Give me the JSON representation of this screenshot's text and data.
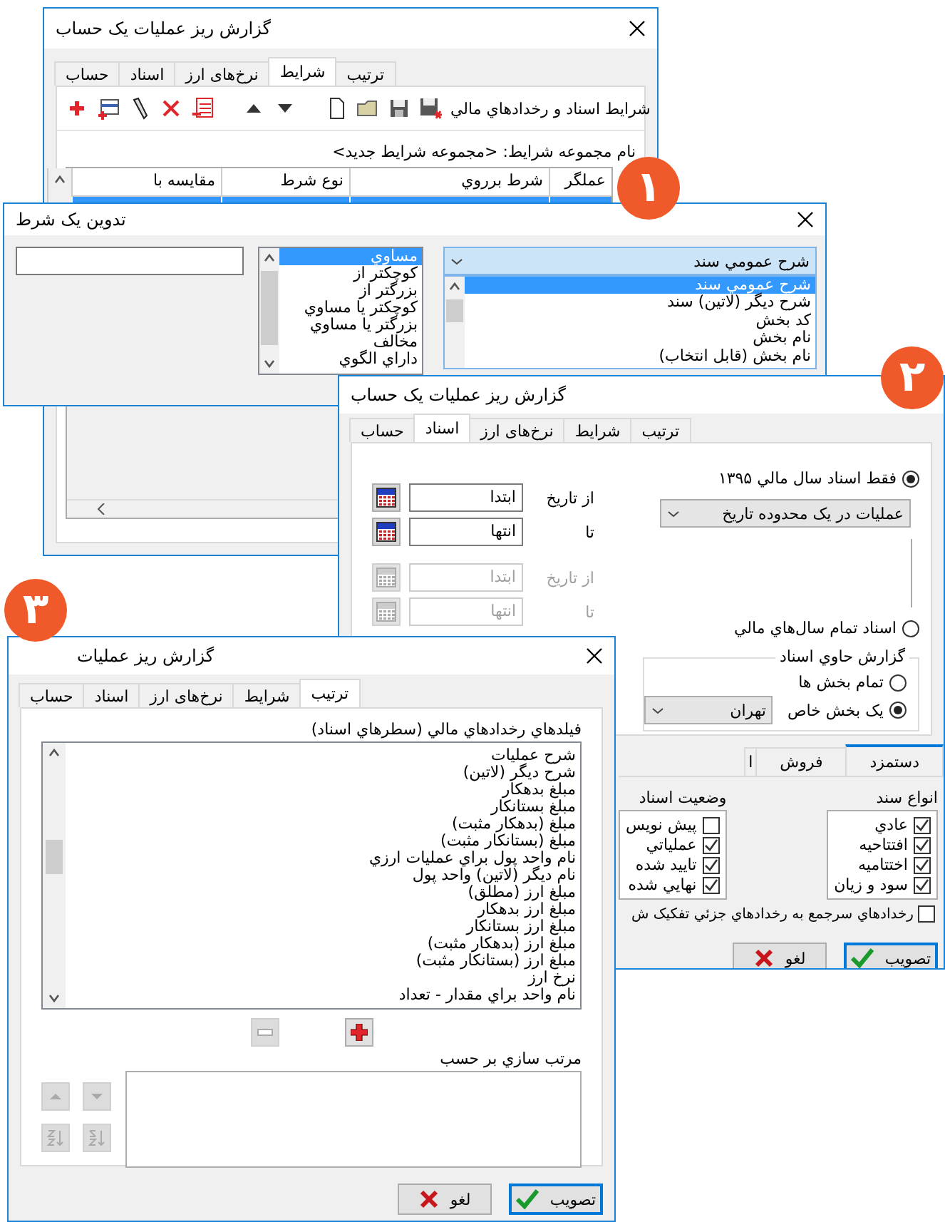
{
  "conditions_window": {
    "title": "گزارش ریز عملیات یک حساب",
    "tabs": [
      {
        "label": "ترتیب",
        "selected": false
      },
      {
        "label": "شرایط",
        "selected": true
      },
      {
        "label": "نرخ‌های ارز",
        "selected": false
      },
      {
        "label": "اسناد",
        "selected": false
      },
      {
        "label": "حساب",
        "selected": false
      }
    ],
    "toolbar_label": "شرایط اسناد و رخدادهاي مالي",
    "set_name": "نام مجموعه شرایط: <مجموعه شرایط جدید>",
    "table": {
      "columns": [
        "عملگر",
        "شرط برروي",
        "نوع شرط",
        "مقایسه با"
      ],
      "rows": [
        {
          "selected": true
        }
      ]
    }
  },
  "edit_condition_dialog": {
    "title": "تدوین یک شرط",
    "field_combo": {
      "value": "شرح عمومي سند",
      "options": [
        {
          "label": "شرح عمومي سند",
          "selected": true
        },
        {
          "label": "شرح دیگر (لاتین) سند",
          "selected": false
        },
        {
          "label": "کد بخش",
          "selected": false
        },
        {
          "label": "نام بخش",
          "selected": false
        },
        {
          "label": "نام بخش (قابل انتخاب)",
          "selected": false
        }
      ]
    },
    "operators": [
      {
        "label": "مساوي",
        "selected": true
      },
      {
        "label": "کوچکتر از",
        "selected": false
      },
      {
        "label": "بزرگتر از",
        "selected": false
      },
      {
        "label": "کوچکتر یا مساوي",
        "selected": false
      },
      {
        "label": "بزرگتر یا مساوي",
        "selected": false
      },
      {
        "label": "مخالف",
        "selected": false
      },
      {
        "label": "داراي الگوي",
        "selected": false
      }
    ]
  },
  "documents_window": {
    "title": "گزارش ریز عملیات یک حساب",
    "tabs": [
      {
        "label": "ترتیب",
        "selected": false
      },
      {
        "label": "شرایط",
        "selected": false
      },
      {
        "label": "نرخ‌های ارز",
        "selected": false
      },
      {
        "label": "اسناد",
        "selected": true
      },
      {
        "label": "حساب",
        "selected": false
      }
    ],
    "scope_options": [
      {
        "label": "فقط اسناد سال مالي ۱۳۹۵",
        "selected": true,
        "range_combo": "عملیات در یک محدوده تاریخ",
        "dates": [
          {
            "label": "از تاریخ",
            "value": "ابتدا",
            "disabled": false
          },
          {
            "label": "تا",
            "value": "انتها",
            "disabled": false
          }
        ]
      },
      {
        "label": "اسناد تمام سال‌هاي مالي",
        "selected": false,
        "dates": [
          {
            "label": "از تاریخ",
            "value": "ابتدا",
            "disabled": true
          },
          {
            "label": "تا",
            "value": "انتها",
            "disabled": true
          }
        ]
      }
    ],
    "contains_group": {
      "title": "گزارش حاوي اسناد",
      "options": [
        {
          "label": "تمام بخش ها",
          "selected": false
        },
        {
          "label": "یک بخش خاص",
          "selected": true
        }
      ],
      "section_combo": "تهران"
    },
    "inner_tabs": [
      {
        "label": "دستمزد",
        "selected": true
      },
      {
        "label": "فروش",
        "selected": false
      },
      {
        "label": "ا",
        "selected": false
      }
    ],
    "doc_types": {
      "title": "انواع سند",
      "items": [
        {
          "label": "عادي",
          "checked": true
        },
        {
          "label": "افتتاحیه",
          "checked": true
        },
        {
          "label": "اختتامیه",
          "checked": true
        },
        {
          "label": "سود و زیان",
          "checked": true
        }
      ]
    },
    "doc_status": {
      "title": "وضعیت اسناد",
      "items": [
        {
          "label": "پیش نویس",
          "checked": false
        },
        {
          "label": "عملیاتي",
          "checked": true
        },
        {
          "label": "تایید شده",
          "checked": true
        },
        {
          "label": "نهایي شده",
          "checked": true
        }
      ]
    },
    "split_checkbox": {
      "label": "رخدادهاي سرجمع به رخدادهاي جزئي تفکیک ش",
      "checked": false
    },
    "buttons": [
      {
        "label": "تصویب",
        "kind": "ok"
      },
      {
        "label": "لغو",
        "kind": "cancel"
      }
    ]
  },
  "sort_window": {
    "title": "گزارش ریز عملیات",
    "tabs": [
      {
        "label": "ترتیب",
        "selected": true
      },
      {
        "label": "شرایط",
        "selected": false
      },
      {
        "label": "نرخ‌های ارز",
        "selected": false
      },
      {
        "label": "اسناد",
        "selected": false
      },
      {
        "label": "حساب",
        "selected": false
      }
    ],
    "fields_label": "فیلدهاي رخدادهاي مالي (سطرهاي اسناد)",
    "fields": [
      "شرح عملیات",
      "شرح دیگر (لاتین)",
      "مبلغ بدهکار",
      "مبلغ بستانکار",
      "مبلغ (بدهکار مثبت)",
      "مبلغ (بستانکار مثبت)",
      "نام واحد پول براي عملیات ارزي",
      "نام دیگر (لاتین) واحد پول",
      "مبلغ ارز (مطلق)",
      "مبلغ ارز بدهکار",
      "مبلغ ارز بستانکار",
      "مبلغ ارز (بدهکار مثبت)",
      "مبلغ ارز (بستانکار مثبت)",
      "نرخ ارز",
      "نام واحد براي مقدار - تعداد"
    ],
    "move_buttons": [
      {
        "kind": "remove",
        "disabled": true
      },
      {
        "kind": "add",
        "disabled": false
      }
    ],
    "sort_label": "مرتب سازي بر حسب",
    "order_buttons": [
      {
        "kind": "up",
        "disabled": true
      },
      {
        "kind": "down",
        "disabled": true
      },
      {
        "kind": "sort-asc",
        "disabled": true
      },
      {
        "kind": "sort-desc",
        "disabled": true
      }
    ],
    "buttons": [
      {
        "label": "تصویب",
        "kind": "ok"
      },
      {
        "label": "لغو",
        "kind": "cancel"
      }
    ]
  },
  "badges": [
    "۱",
    "۲",
    "۳"
  ]
}
